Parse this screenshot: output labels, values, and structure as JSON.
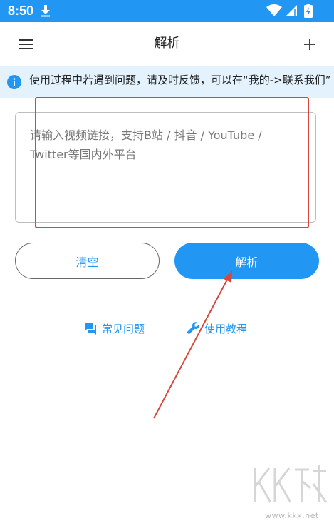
{
  "status_bar": {
    "time": "8:50",
    "icons": [
      "download-icon",
      "wifi-icon",
      "signal-icon",
      "battery-charging-icon"
    ]
  },
  "toolbar": {
    "title": "解析",
    "menu_icon": "menu-icon",
    "add_icon": "plus-icon"
  },
  "notice": {
    "icon": "info-icon",
    "text": "使用过程中若遇到问题，请及时反馈，可以在“我的->联系我们”"
  },
  "input": {
    "value": "",
    "placeholder": "请输入视频链接，支持B站 / 抖音 / YouTube / Twitter等国内外平台"
  },
  "buttons": {
    "clear_label": "清空",
    "parse_label": "解析"
  },
  "help_links": {
    "faq_label": "常见问题",
    "faq_icon": "chat-bubble-icon",
    "tutorial_label": "使用教程",
    "tutorial_icon": "wrench-icon"
  },
  "watermark": {
    "brand": "KK下载",
    "url": "www.kkx.net"
  },
  "colors": {
    "primary": "#2196F3",
    "notice_background": "#E3F2FD",
    "annotation": "#D9473B"
  }
}
